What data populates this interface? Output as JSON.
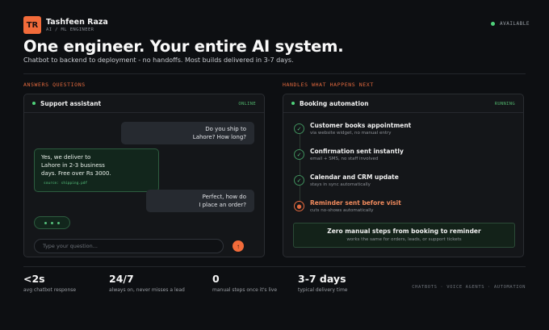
{
  "header": {
    "avatar_initials": "TR",
    "name": "Tashfeen Raza",
    "role": "AI / ML ENGINEER",
    "status": "AVAILABLE",
    "headline": "One engineer. Your entire AI system.",
    "subheadline": "Chatbot to backend to deployment - no handoffs. Most builds delivered in 3-7 days."
  },
  "left": {
    "section_label": "ANSWERS QUESTIONS",
    "panel_title": "Support assistant",
    "panel_status": "ONLINE",
    "messages": [
      {
        "from": "user",
        "line1": "Do you ship to",
        "line2": "Lahore? How long?"
      },
      {
        "from": "bot",
        "line1": "Yes, we deliver to",
        "line2": "Lahore in 2-3 business",
        "line3": "days. Free over Rs 3000.",
        "source": "source: shipping.pdf"
      },
      {
        "from": "user",
        "line1": "Perfect, how do",
        "line2": "I place an order?"
      }
    ],
    "input_placeholder": "Type your question...",
    "send_icon": "↑"
  },
  "right": {
    "section_label": "HANDLES WHAT HAPPENS NEXT",
    "panel_title": "Booking automation",
    "panel_status": "RUNNING",
    "steps": [
      {
        "title": "Customer books appointment",
        "desc": "via website widget, no manual entry",
        "icon": "✓"
      },
      {
        "title": "Confirmation sent instantly",
        "desc": "email + SMS, no staff involved",
        "icon": "✓"
      },
      {
        "title": "Calendar and CRM update",
        "desc": "stays in sync automatically",
        "icon": "✓"
      },
      {
        "title": "Reminder sent before visit",
        "desc": "cuts no-shows automatically",
        "icon": "●"
      }
    ],
    "summary_title": "Zero manual steps from booking to reminder",
    "summary_desc": "works the same for orders, leads, or support tickets"
  },
  "stats": [
    {
      "value": "<2s",
      "label": "avg chatbot response"
    },
    {
      "value": "24/7",
      "label": "always on, never misses a lead"
    },
    {
      "value": "0",
      "label": "manual steps once it's live"
    },
    {
      "value": "3-7 days",
      "label": "typical delivery time"
    }
  ],
  "footer_tags": "CHATBOTS · VOICE AGENTS · AUTOMATION",
  "colors": {
    "accent": "#f26b3a",
    "online": "#4fd27a",
    "background": "#0d0f12"
  }
}
